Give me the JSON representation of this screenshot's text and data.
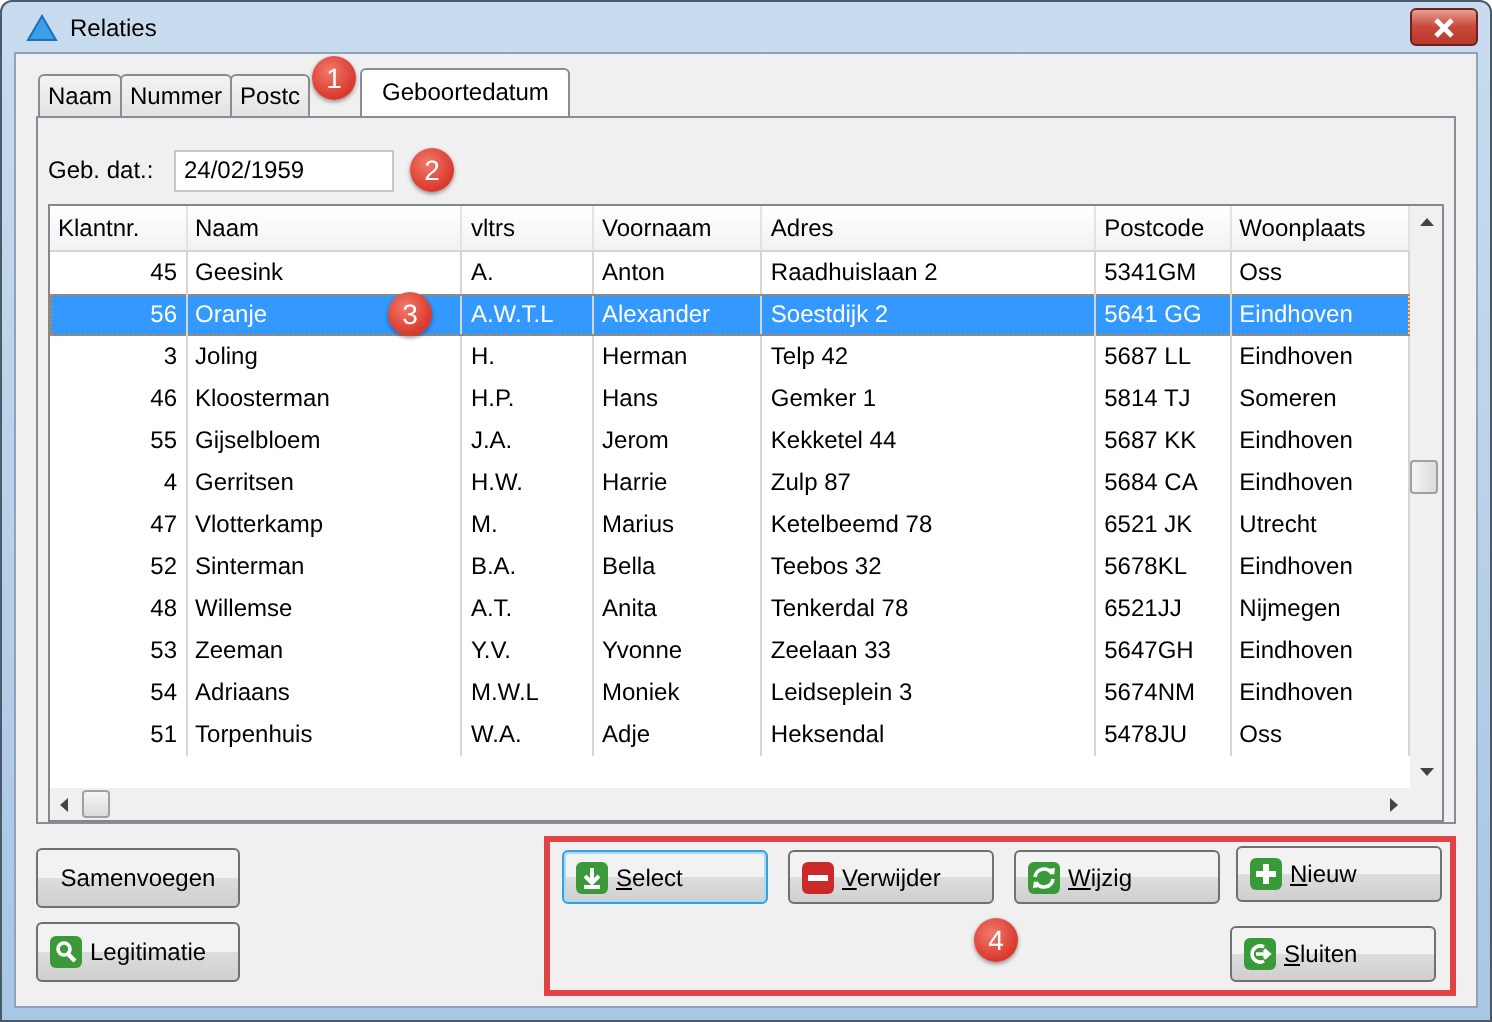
{
  "window": {
    "title": "Relaties"
  },
  "tabs": [
    {
      "label": "Naam",
      "selected": false
    },
    {
      "label": "Nummer",
      "selected": false
    },
    {
      "label": "Postc",
      "selected": false
    },
    {
      "label": "Geboortedatum",
      "selected": true
    }
  ],
  "tabs_badge": "1",
  "date_field": {
    "label": "Geb. dat.:",
    "value": "24/02/1959",
    "badge": "2"
  },
  "table": {
    "columns": [
      "Klantnr.",
      "Naam",
      "vltrs",
      "Voornaam",
      "Adres",
      "Postcode",
      "Woonplaats"
    ],
    "rows": [
      {
        "cells": [
          "45",
          "Geesink",
          "A.",
          "Anton",
          "Raadhuislaan 2",
          "5341GM",
          "Oss"
        ],
        "selected": false
      },
      {
        "cells": [
          "56",
          "Oranje",
          "A.W.T.L",
          "Alexander",
          "Soestdijk 2",
          "5641 GG",
          "Eindhoven"
        ],
        "selected": true,
        "badge": "3"
      },
      {
        "cells": [
          "3",
          "Joling",
          "H.",
          "Herman",
          "Telp 42",
          "5687 LL",
          "Eindhoven"
        ],
        "selected": false
      },
      {
        "cells": [
          "46",
          "Kloosterman",
          "H.P.",
          "Hans",
          "Gemker 1",
          "5814 TJ",
          "Someren"
        ],
        "selected": false
      },
      {
        "cells": [
          "55",
          "Gijselbloem",
          "J.A.",
          "Jerom",
          "Kekketel 44",
          "5687 KK",
          "Eindhoven"
        ],
        "selected": false
      },
      {
        "cells": [
          "4",
          "Gerritsen",
          "H.W.",
          "Harrie",
          "Zulp 87",
          "5684 CA",
          "Eindhoven"
        ],
        "selected": false
      },
      {
        "cells": [
          "47",
          "Vlotterkamp",
          "M.",
          "Marius",
          "Ketelbeemd 78",
          "6521 JK",
          "Utrecht"
        ],
        "selected": false
      },
      {
        "cells": [
          "52",
          "Sinterman",
          "B.A.",
          "Bella",
          "Teebos 32",
          "5678KL",
          "Eindhoven"
        ],
        "selected": false
      },
      {
        "cells": [
          "48",
          "Willemse",
          "A.T.",
          "Anita",
          "Tenkerdal 78",
          "6521JJ",
          "Nijmegen"
        ],
        "selected": false
      },
      {
        "cells": [
          "53",
          "Zeeman",
          "Y.V.",
          "Yvonne",
          "Zeelaan 33",
          "5647GH",
          "Eindhoven"
        ],
        "selected": false
      },
      {
        "cells": [
          "54",
          "Adriaans",
          "M.W.L",
          "Moniek",
          "Leidseplein 3",
          "5674NM",
          "Eindhoven"
        ],
        "selected": false
      },
      {
        "cells": [
          "51",
          "Torpenhuis",
          "W.A.",
          "Adje",
          "Heksendal",
          "5478JU",
          "Oss"
        ],
        "selected": false
      }
    ]
  },
  "left_buttons": [
    {
      "label": "Samenvoegen"
    },
    {
      "label": "Legitimatie"
    }
  ],
  "action_panel": {
    "badge": "4",
    "buttons": [
      {
        "label": "Select",
        "mnemonic": true,
        "focused": true
      },
      {
        "label": "Verwijder",
        "mnemonic": true,
        "focused": false
      },
      {
        "label": "Wijzig",
        "mnemonic": true,
        "focused": false
      },
      {
        "label": "Nieuw",
        "mnemonic": true,
        "focused": false
      },
      {
        "label": "Sluiten",
        "mnemonic": true,
        "focused": false
      }
    ]
  }
}
